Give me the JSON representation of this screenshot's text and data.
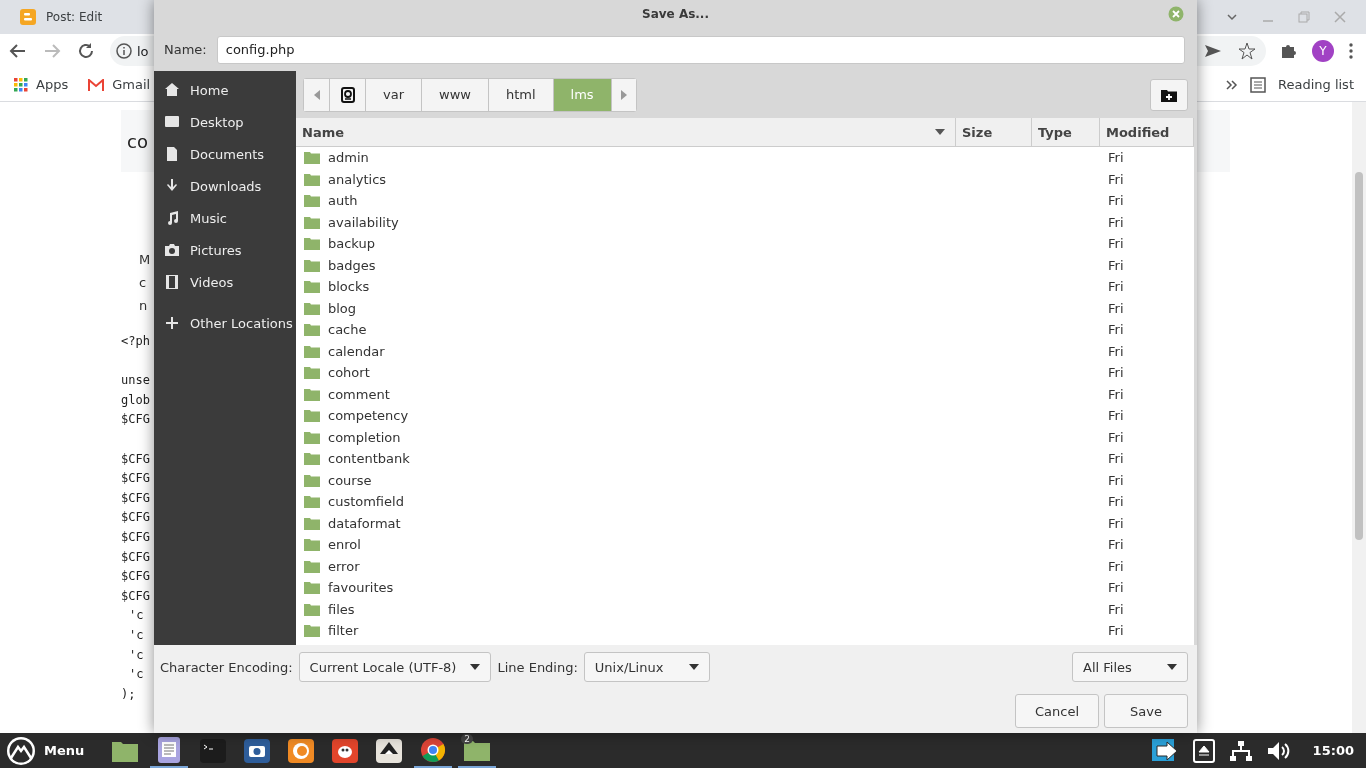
{
  "browser": {
    "tab_title": "Post: Edit",
    "address": "lo",
    "bookmarks": [
      "Apps",
      "Gmail"
    ],
    "reading_list": "Reading list",
    "avatar": "Y"
  },
  "page": {
    "heading": "co",
    "intro": [
      "M",
      "c",
      "n"
    ],
    "code_blocks": [
      [
        {
          "text": "<?ph",
          "indented": false
        }
      ],
      [
        {
          "text": "unse",
          "indented": false
        },
        {
          "text": "glob",
          "indented": false
        },
        {
          "text": "$CFG",
          "indented": false
        }
      ],
      [
        {
          "text": "$CFG",
          "indented": false
        },
        {
          "text": "$CFG",
          "indented": false
        },
        {
          "text": "$CFG",
          "indented": false
        },
        {
          "text": "$CFG",
          "indented": false
        },
        {
          "text": "$CFG",
          "indented": false
        },
        {
          "text": "$CFG",
          "indented": false
        },
        {
          "text": "$CFG",
          "indented": false
        },
        {
          "text": "$CFG",
          "indented": false
        },
        {
          "text": "'c",
          "indented": true
        },
        {
          "text": "'c",
          "indented": true
        },
        {
          "text": "'c",
          "indented": true
        },
        {
          "text": "'c",
          "indented": true
        },
        {
          "text": ");",
          "indented": false
        }
      ]
    ]
  },
  "dialog": {
    "title": "Save As...",
    "name_label": "Name:",
    "name_value": "config.php",
    "places": [
      {
        "label": "Home",
        "kind": "home"
      },
      {
        "label": "Desktop",
        "kind": "desktop"
      },
      {
        "label": "Documents",
        "kind": "documents"
      },
      {
        "label": "Downloads",
        "kind": "downloads"
      },
      {
        "label": "Music",
        "kind": "music"
      },
      {
        "label": "Pictures",
        "kind": "pictures"
      },
      {
        "label": "Videos",
        "kind": "videos"
      },
      {
        "label": "Other Locations",
        "kind": "other"
      }
    ],
    "path": [
      {
        "label": "var",
        "selected": false
      },
      {
        "label": "www",
        "selected": false
      },
      {
        "label": "html",
        "selected": false
      },
      {
        "label": "lms",
        "selected": true
      }
    ],
    "columns": [
      {
        "label": "Name",
        "sorted": true
      },
      {
        "label": "Size",
        "sorted": false
      },
      {
        "label": "Type",
        "sorted": false
      },
      {
        "label": "Modified",
        "sorted": false
      }
    ],
    "files": [
      {
        "name": "admin",
        "modified": "Fri"
      },
      {
        "name": "analytics",
        "modified": "Fri"
      },
      {
        "name": "auth",
        "modified": "Fri"
      },
      {
        "name": "availability",
        "modified": "Fri"
      },
      {
        "name": "backup",
        "modified": "Fri"
      },
      {
        "name": "badges",
        "modified": "Fri"
      },
      {
        "name": "blocks",
        "modified": "Fri"
      },
      {
        "name": "blog",
        "modified": "Fri"
      },
      {
        "name": "cache",
        "modified": "Fri"
      },
      {
        "name": "calendar",
        "modified": "Fri"
      },
      {
        "name": "cohort",
        "modified": "Fri"
      },
      {
        "name": "comment",
        "modified": "Fri"
      },
      {
        "name": "competency",
        "modified": "Fri"
      },
      {
        "name": "completion",
        "modified": "Fri"
      },
      {
        "name": "contentbank",
        "modified": "Fri"
      },
      {
        "name": "course",
        "modified": "Fri"
      },
      {
        "name": "customfield",
        "modified": "Fri"
      },
      {
        "name": "dataformat",
        "modified": "Fri"
      },
      {
        "name": "enrol",
        "modified": "Fri"
      },
      {
        "name": "error",
        "modified": "Fri"
      },
      {
        "name": "favourites",
        "modified": "Fri"
      },
      {
        "name": "files",
        "modified": "Fri"
      },
      {
        "name": "filter",
        "modified": "Fri"
      }
    ],
    "encoding_label": "Character Encoding:",
    "encoding_value": "Current Locale (UTF-8)",
    "line_ending_label": "Line Ending:",
    "line_ending_value": "Unix/Linux",
    "filter_value": "All Files",
    "buttons": [
      "Cancel",
      "Save"
    ]
  },
  "taskbar": {
    "menu_label": "Menu",
    "apps": [
      {
        "kind": "folder",
        "running": false
      },
      {
        "kind": "editor",
        "running": true
      },
      {
        "kind": "terminal",
        "running": false
      },
      {
        "kind": "camera",
        "running": false
      },
      {
        "kind": "firefox",
        "running": false
      },
      {
        "kind": "gimp",
        "running": false
      },
      {
        "kind": "inkscape",
        "running": false
      },
      {
        "kind": "chrome",
        "running": true
      },
      {
        "kind": "files",
        "running": true,
        "badge": "2"
      }
    ],
    "clock": "15:00"
  }
}
